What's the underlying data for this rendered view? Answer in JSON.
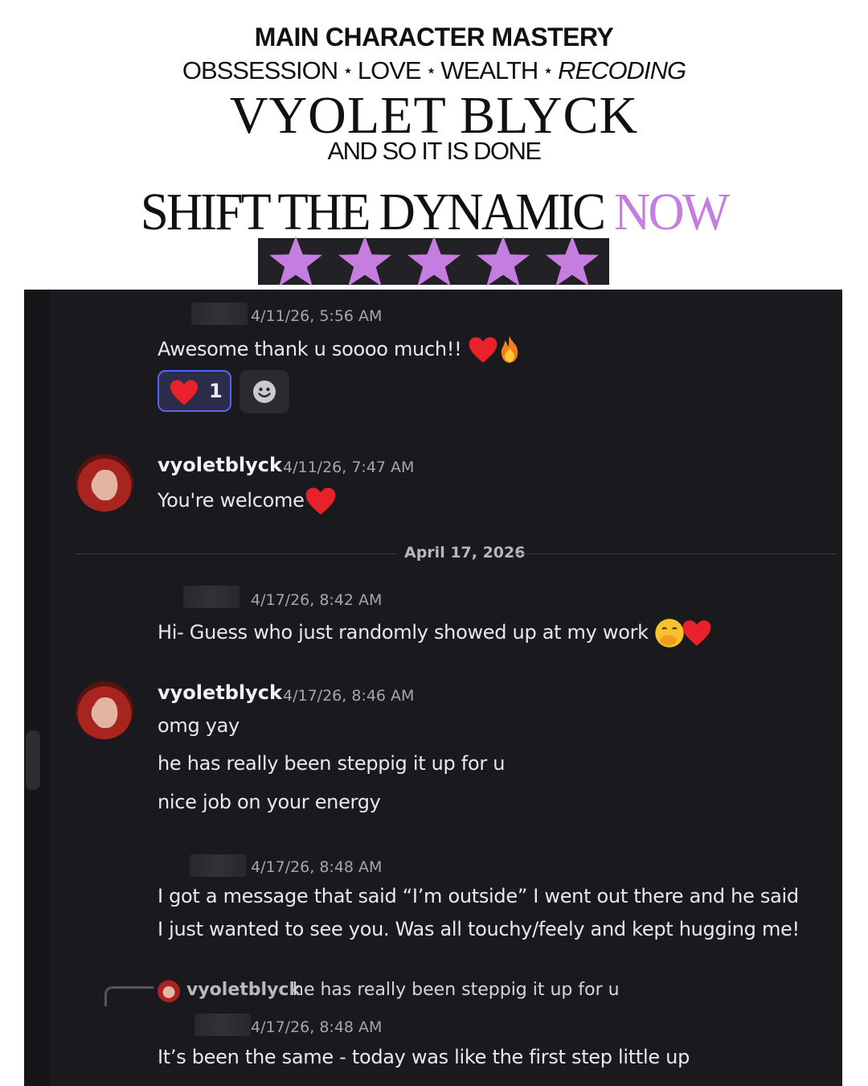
{
  "header": {
    "title": "MAIN CHARACTER MASTERY",
    "tags": [
      "OBSSESSION",
      "LOVE",
      "WEALTH",
      "RECODING"
    ],
    "tag_separator": "⋆",
    "name": "VYOLET BLYCK",
    "tagline": "AND SO IT IS DONE",
    "headline_main": "SHIFT THE DYNAMIC",
    "headline_accent": "NOW",
    "accent_color": "#c57ee0",
    "star_rating": 5
  },
  "chat": {
    "messages": [
      {
        "timestamp": "4/11/26, 5:56 AM",
        "text": "Awesome thank u soooo much!!",
        "emojis": [
          "red-heart",
          "fire"
        ],
        "reaction": {
          "emoji": "red-heart",
          "count": "1"
        }
      },
      {
        "username": "vyoletblyck",
        "timestamp": "4/11/26, 7:47 AM",
        "text": "You're welcome",
        "emojis": [
          "red-heart"
        ]
      },
      {
        "timestamp": "4/17/26, 8:42 AM",
        "text": "Hi- Guess who just randomly showed up at my work",
        "emojis": [
          "hand-over-mouth",
          "red-heart"
        ]
      },
      {
        "username": "vyoletblyck",
        "timestamp": "4/17/26, 8:46 AM",
        "lines": [
          "omg yay",
          "he has really been steppig it up for u",
          "nice job on your energy"
        ]
      },
      {
        "timestamp": "4/17/26, 8:48 AM",
        "lines": [
          "I got a message that said “I’m outside” I went out there and he said",
          "I just wanted to see you. Was all touchy/feely and kept hugging me!"
        ]
      },
      {
        "reply_to": {
          "username": "vyoletblyck",
          "text": "he has really been steppig it up for u"
        },
        "timestamp": "4/17/26, 8:48 AM",
        "text": "It’s been the same - today was like the first step little up"
      }
    ],
    "date_divider": "April 17, 2026"
  }
}
